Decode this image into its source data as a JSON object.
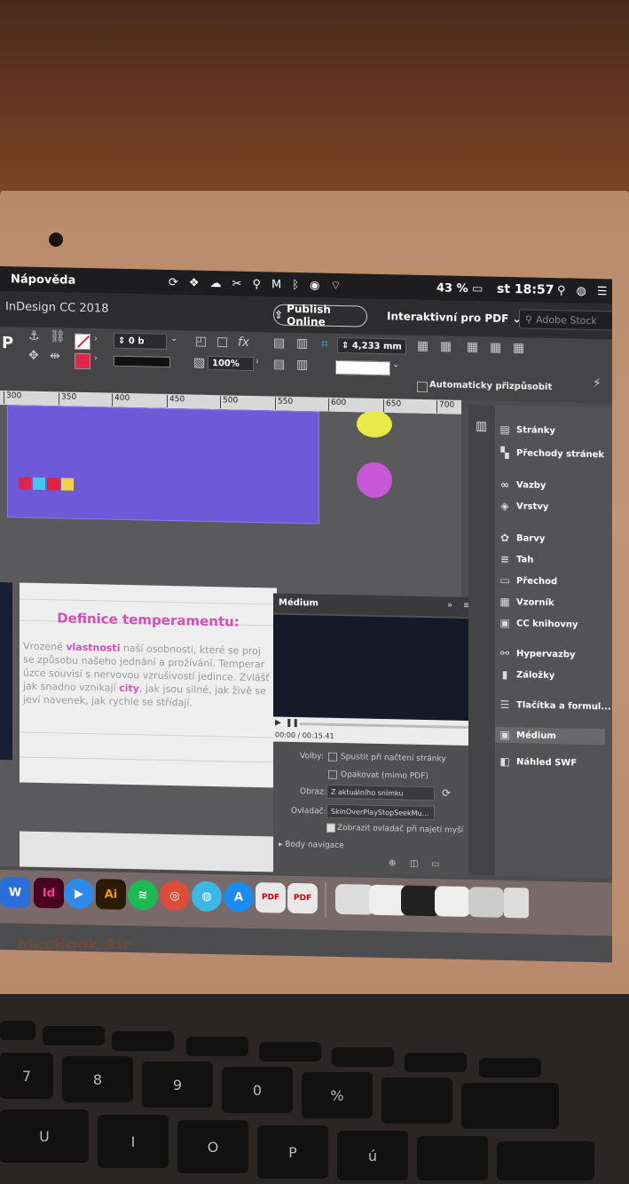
{
  "menubar": {
    "help": "Nápověda",
    "battery": "43 %",
    "clock": "st 18:57"
  },
  "app": {
    "title": "InDesign CC 2018",
    "publish_label": "Publish Online",
    "workspace": "Interaktivní pro PDF",
    "search_placeholder": "Adobe Stock"
  },
  "control": {
    "stroke_weight": "0 b",
    "scale": "100%",
    "size": "4,233 mm",
    "autofit": "Automaticky přizpůsobit"
  },
  "ruler": [
    "300",
    "350",
    "400",
    "450",
    "500",
    "550",
    "600",
    "650",
    "700"
  ],
  "document": {
    "heading": "Definice temperamentu:",
    "body_lines": [
      [
        "Vrozené ",
        "vlastnosti",
        " naší osobnosti, které se proj"
      ],
      [
        "se způsobu našeho jednání a prožívání. Temperar"
      ],
      [
        "úzce souvisí s nervovou vzrušivostí jedince. Zvlášť"
      ],
      [
        "jak snadno vznikají ",
        "city",
        ", jak jsou silné, jak živě se"
      ],
      [
        "jeví navenek, jak rychle se střídají."
      ]
    ]
  },
  "medium_panel": {
    "title": "Médium",
    "time": "00:00 / 00:15.41",
    "volby_label": "Volby:",
    "option_1": "Spustit při načtení stránky",
    "option_2": "Opakovat (mimo PDF)",
    "obraz_label": "Obraz:",
    "obraz_value": "Z aktuálního snímku",
    "ovladac_label": "Ovladač:",
    "ovladac_value": "SkinOverPlayStopSeekMu...",
    "show_controls": "Zobrazit ovladač při najetí myší",
    "nav_points": "Body navigace"
  },
  "side_panel": {
    "items": [
      "Stránky",
      "Přechody stránek",
      "Vazby",
      "Vrstvy",
      "Barvy",
      "Tah",
      "Přechod",
      "Vzorník",
      "CC knihovny",
      "Hypervazby",
      "Záložky",
      "Tlačítka a formul...",
      "Médium",
      "Náhled SWF"
    ]
  },
  "dock": [
    "Id",
    "Ai",
    "PDF",
    "PDF"
  ],
  "laptop": {
    "label": "MacBook Air"
  },
  "keyboard": [
    "7",
    "8",
    "9",
    "0",
    "%",
    "U",
    "I",
    "O",
    "P",
    "ú"
  ],
  "colors": {
    "accent_pink": "#d34fb8",
    "document_purple": "#6e5ad8",
    "circle_yellow": "#e8ea4a",
    "circle_magenta": "#c859d6",
    "indesign_pink": "#ff3d9a",
    "illustrator_orange": "#ff9a00"
  }
}
